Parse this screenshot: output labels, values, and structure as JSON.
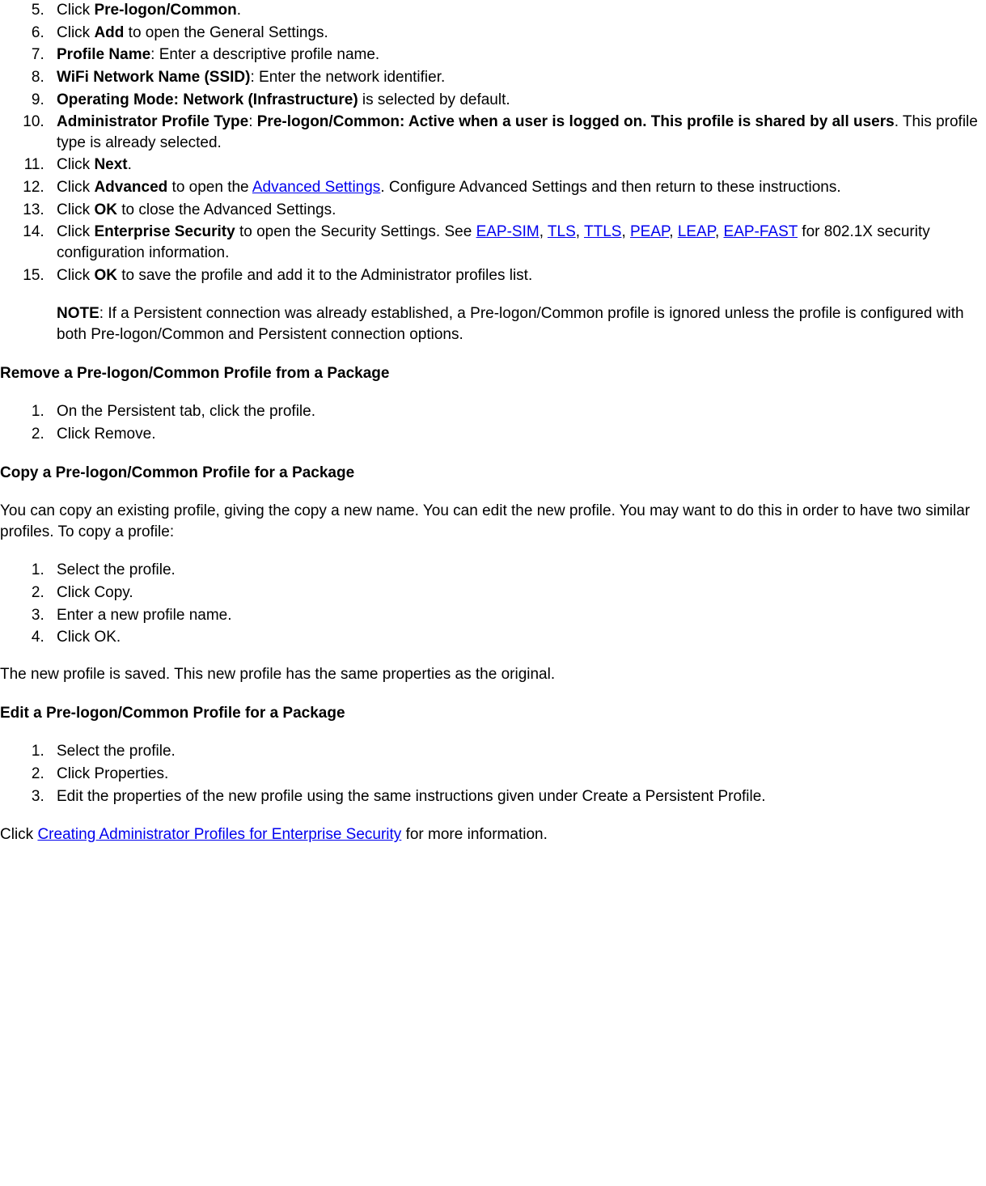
{
  "list1": {
    "start": 5,
    "items": [
      {
        "prefix": "Click ",
        "bold1": "Pre-logon/Common",
        "suffix1": "."
      },
      {
        "prefix": "Click ",
        "bold1": "Add",
        "suffix1": " to open the General Settings."
      },
      {
        "bold1": "Profile Name",
        "suffix1": ": Enter a descriptive profile name."
      },
      {
        "bold1": "WiFi Network Name (SSID)",
        "suffix1": ": Enter the network identifier."
      },
      {
        "bold1": "Operating Mode: Network (Infrastructure)",
        "suffix1": " is selected by default."
      },
      {
        "bold1": "Administrator Profile Type",
        "mid": ": ",
        "bold2": "Pre-logon/Common: Active when a user is logged on. This profile is shared by all users",
        "suffix1": ". This profile type is already selected."
      },
      {
        "prefix": "Click ",
        "bold1": "Next",
        "suffix1": "."
      },
      {
        "prefix": "Click ",
        "bold1": "Advanced",
        "suffix1": " to open the ",
        "link1": "Advanced Settings",
        "suffix2": ". Configure Advanced Settings and then return to these instructions."
      },
      {
        "prefix": "Click ",
        "bold1": "OK",
        "suffix1": " to close the Advanced Settings."
      },
      {
        "prefix": "Click ",
        "bold1": "Enterprise Security",
        "suffix1": " to open the Security Settings. See ",
        "link1": "EAP-SIM",
        "sep1": ", ",
        "link2": "TLS",
        "sep2": ", ",
        "link3": "TTLS",
        "sep3": ", ",
        "link4": "PEAP",
        "sep4": ", ",
        "link5": "LEAP",
        "sep5": ", ",
        "link6": "EAP-FAST",
        "suffix2": " for 802.1X security configuration information."
      },
      {
        "prefix": "Click ",
        "bold1": "OK",
        "suffix1": " to save the profile and add it to the Administrator profiles list.",
        "note_label": "NOTE",
        "note_text": ": If a Persistent connection was already established, a Pre-logon/Common profile is ignored unless the profile is configured with both Pre-logon/Common and Persistent connection options."
      }
    ]
  },
  "heading1": "Remove a Pre-logon/Common Profile from a Package",
  "list2": [
    "On the Persistent tab, click the profile.",
    "Click Remove."
  ],
  "heading2": "Copy a Pre-logon/Common Profile for a Package",
  "para1": "You can copy an existing profile, giving the copy a new name. You can edit the new profile. You may want to do this in order to have two similar profiles. To copy a profile:",
  "list3": [
    "Select the profile.",
    "Click Copy.",
    "Enter a new profile name.",
    "Click OK."
  ],
  "para2": "The new profile is saved. This new profile has the same properties as the original.",
  "heading3": "Edit a Pre-logon/Common Profile for a Package",
  "list4": [
    "Select the profile.",
    "Click Properties.",
    "Edit the properties of the new profile using the same instructions given under Create a Persistent Profile."
  ],
  "final": {
    "prefix": "Click ",
    "link": "Creating Administrator Profiles for Enterprise Security",
    "suffix": " for more information."
  }
}
